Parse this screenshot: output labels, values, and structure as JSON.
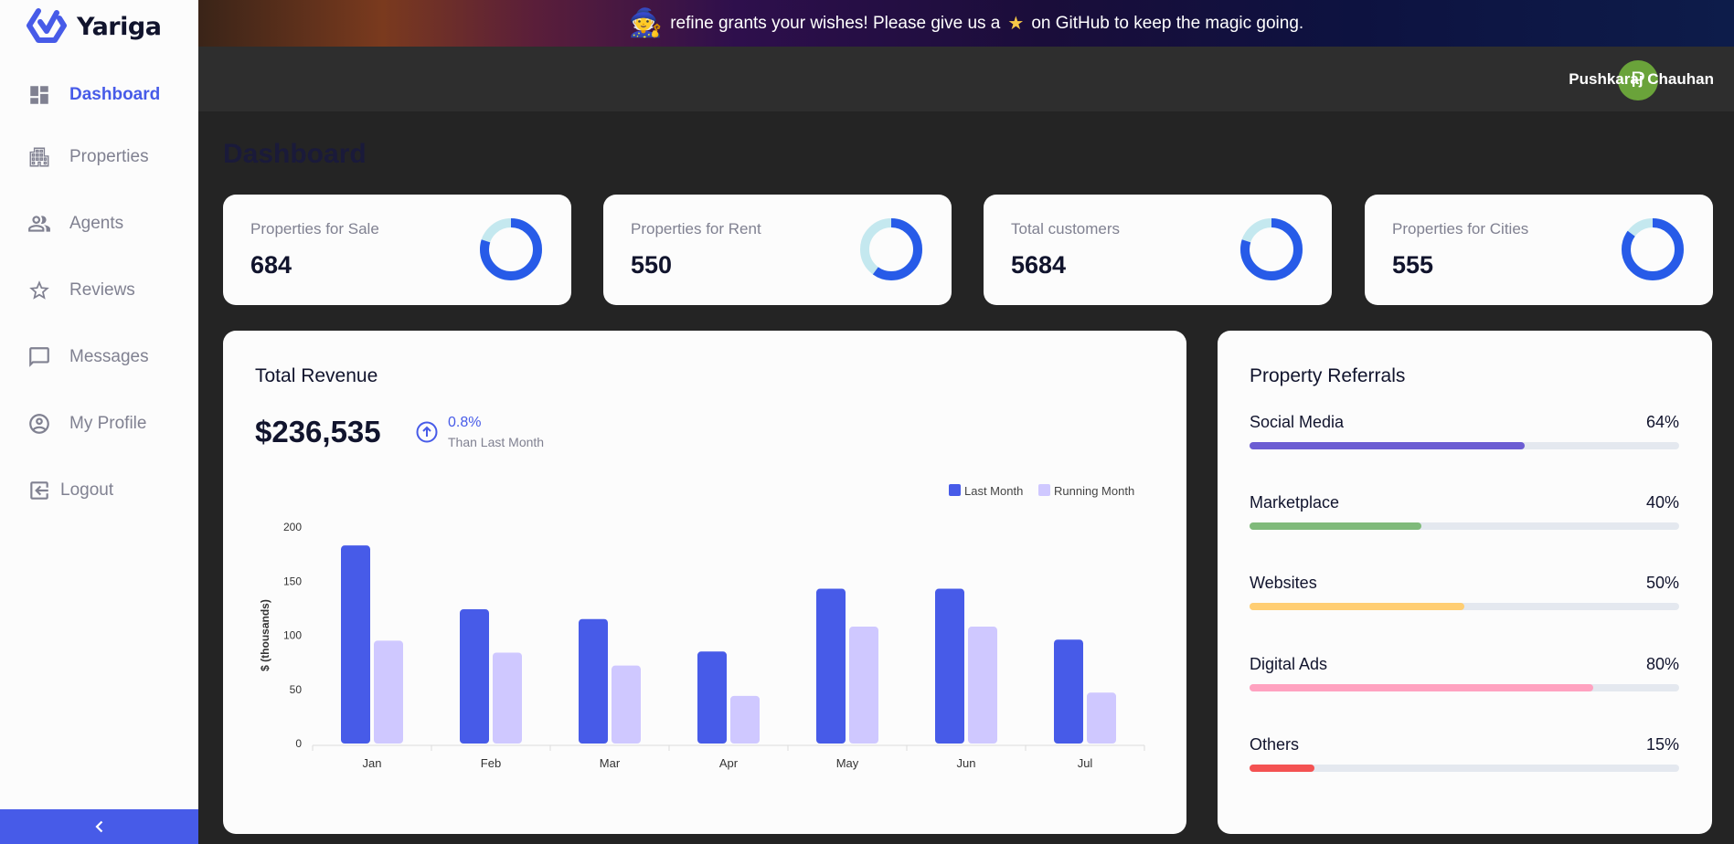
{
  "app": {
    "name": "Yariga"
  },
  "sidebar": {
    "items": [
      {
        "label": "Dashboard",
        "icon": "dashboard-icon",
        "active": true
      },
      {
        "label": "Properties",
        "icon": "building-icon",
        "active": false
      },
      {
        "label": "Agents",
        "icon": "people-icon",
        "active": false
      },
      {
        "label": "Reviews",
        "icon": "star-icon",
        "active": false
      },
      {
        "label": "Messages",
        "icon": "chat-icon",
        "active": false
      },
      {
        "label": "My Profile",
        "icon": "account-circle-icon",
        "active": false
      },
      {
        "label": "Logout",
        "icon": "logout-icon",
        "active": false
      }
    ],
    "collapse_icon": "chevron-left-icon"
  },
  "banner": {
    "text_before": "refine grants your wishes! Please give us a",
    "text_after": "on GitHub to keep the magic going."
  },
  "header": {
    "user_name": "Pushkaraj Chauhan",
    "avatar_initial": "P",
    "avatar_color": "#6aa33a"
  },
  "page": {
    "title": "Dashboard"
  },
  "stats": [
    {
      "label": "Properties for Sale",
      "value": "684",
      "fraction": 0.8
    },
    {
      "label": "Properties for Rent",
      "value": "550",
      "fraction": 0.6
    },
    {
      "label": "Total customers",
      "value": "5684",
      "fraction": 0.8
    },
    {
      "label": "Properties for Cities",
      "value": "555",
      "fraction": 0.85
    }
  ],
  "revenue": {
    "title": "Total Revenue",
    "amount": "$236,535",
    "change": "0.8%",
    "change_note": "Than Last Month"
  },
  "chart_data": {
    "type": "bar",
    "categories": [
      "Jan",
      "Feb",
      "Mar",
      "Apr",
      "May",
      "Jun",
      "Jul"
    ],
    "series": [
      {
        "name": "Last Month",
        "color": "#475be8",
        "values": [
          183,
          124,
          115,
          85,
          143,
          143,
          96
        ]
      },
      {
        "name": "Running Month",
        "color": "#cfc8ff",
        "values": [
          95,
          84,
          72,
          44,
          108,
          108,
          47
        ]
      }
    ],
    "ylabel": "$ (thousands)",
    "yticks": [
      0,
      50,
      100,
      150,
      200
    ],
    "ylim": [
      0,
      200
    ],
    "legend": "top-right"
  },
  "referrals": {
    "title": "Property Referrals",
    "items": [
      {
        "name": "Social Media",
        "percent": 64,
        "percent_label": "64%",
        "color": "#6c5dd3"
      },
      {
        "name": "Marketplace",
        "percent": 40,
        "percent_label": "40%",
        "color": "#7fba7a"
      },
      {
        "name": "Websites",
        "percent": 50,
        "percent_label": "50%",
        "color": "#ffce73"
      },
      {
        "name": "Digital Ads",
        "percent": 80,
        "percent_label": "80%",
        "color": "#ffa2c0"
      },
      {
        "name": "Others",
        "percent": 15,
        "percent_label": "15%",
        "color": "#f45252"
      }
    ]
  },
  "colors": {
    "accent": "#475be8",
    "donut_track": "#c4e8ef",
    "donut_fill": "#275be8"
  }
}
